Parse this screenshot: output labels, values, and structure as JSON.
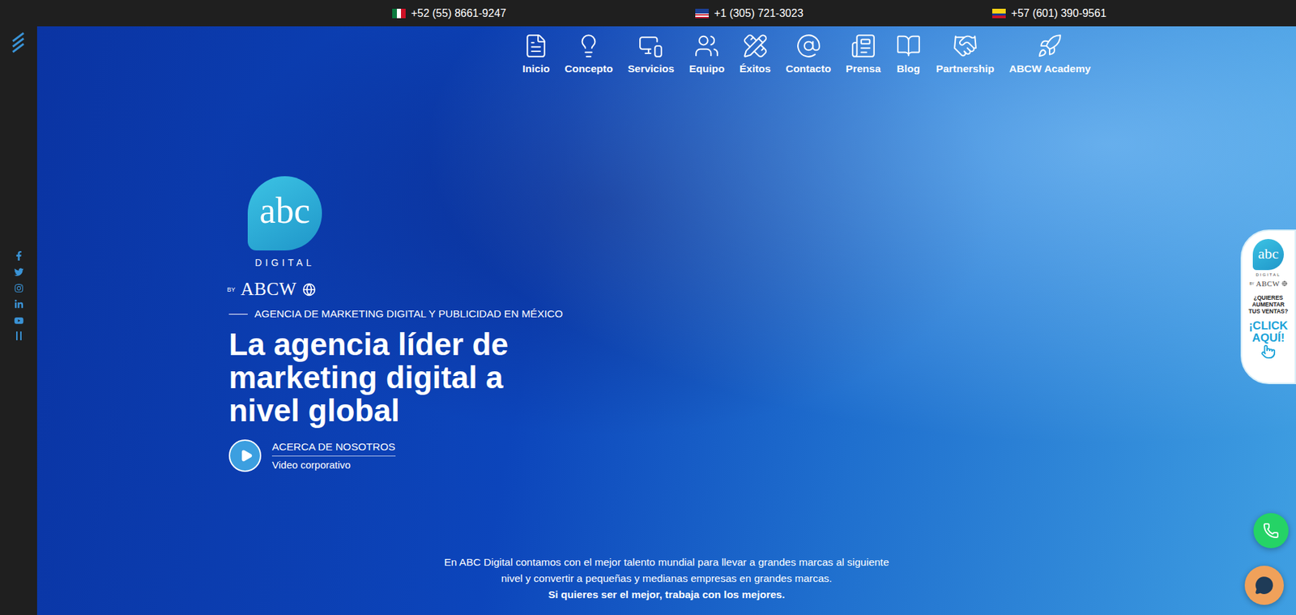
{
  "phones": [
    "+52 (55) 8661-9247",
    "+1 (305) 721-3023",
    "+57 (601) 390-9561"
  ],
  "nav": [
    {
      "label": "Inicio"
    },
    {
      "label": "Concepto"
    },
    {
      "label": "Servicios"
    },
    {
      "label": "Equipo"
    },
    {
      "label": "Éxitos"
    },
    {
      "label": "Contacto"
    },
    {
      "label": "Prensa"
    },
    {
      "label": "Blog"
    },
    {
      "label": "Partnership"
    },
    {
      "label": "ABCW Academy"
    }
  ],
  "logo": {
    "mark": "abc",
    "word": "DIGITAL",
    "by": "BY",
    "brand": "ABCW"
  },
  "hero": {
    "tagline": "AGENCIA DE MARKETING DIGITAL Y PUBLICIDAD EN MÉXICO",
    "heading_lines": [
      "La agencia líder de",
      "marketing digital a",
      "nivel global"
    ],
    "video": {
      "title": "ACERCA DE NOSOTROS",
      "subtitle": "Video corporativo"
    }
  },
  "intro": {
    "lines": [
      "En ABC Digital contamos con el mejor talento mundial para llevar a grandes marcas al siguiente",
      "nivel y convertir a pequeñas y medianas empresas en grandes marcas."
    ],
    "emphasis": "Si quieres ser el mejor, trabaja con los mejores."
  },
  "promo": {
    "mark": "abc",
    "word": "DIGITAL",
    "by": "BY",
    "brand": "ABCW",
    "question": "¿QUIERES AUMENTAR TUS VENTAS?",
    "cta": "¡CLICK AQUÍ!"
  }
}
